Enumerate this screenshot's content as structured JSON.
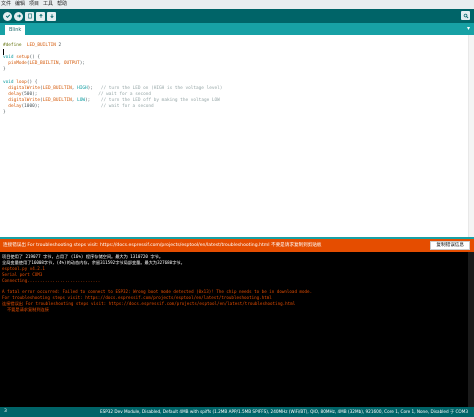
{
  "menu": [
    "文件",
    "编辑",
    "项目",
    "工具",
    "帮助"
  ],
  "toolbar": {
    "verify_icon": "check-icon",
    "upload_icon": "arrow-right-icon",
    "new_icon": "new-file-icon",
    "open_icon": "open-up-icon",
    "save_icon": "save-down-icon",
    "serial_icon": "magnifier-icon"
  },
  "tab": {
    "label": "Blink",
    "menu_glyph": "▾"
  },
  "code": [
    "#define  LED_BUILTIN 2",
    "",
    "void setup() {",
    "  pinMode(LED_BUILTIN, OUTPUT);",
    "}",
    "",
    "void loop() {",
    "  digitalWrite(LED_BUILTIN, HIGH);   // turn the LED on (HIGH is the voltage level)",
    "  delay(500);                       // wait for a second",
    "  digitalWrite(LED_BUILTIN, LOW);    // turn the LED off by making the voltage LOW",
    "  delay(1000);                       // wait for a second",
    "}"
  ],
  "status": {
    "message": "连接错误出 For troubleshooting steps visit: https://docs.espressif.com/projects/esptool/en/latest/troubleshooting.html 不要是请求复制到剪贴板",
    "copy_button": "复制错误信息",
    "color": "#e54d00"
  },
  "console": [
    {
      "text": "项目使用了 219077 字节，占用了 (16%) 程序存储空间。最大为 1310720 字节。",
      "warn": false
    },
    {
      "text": "全局变量使用了16008字节，(4%)的动态内存，余留311592字节局部变量。最大为327680字节。",
      "warn": false
    },
    {
      "text": "esptool.py v4.2.1",
      "warn": true
    },
    {
      "text": "Serial port COM3",
      "warn": true
    },
    {
      "text": "Connecting.............................",
      "warn": true
    },
    {
      "text": "",
      "warn": false
    },
    {
      "text": "A fatal error occurred: Failed to connect to ESP32: Wrong boot mode detected (0x13)! The chip needs to be in download mode.",
      "warn": true
    },
    {
      "text": "For troubleshooting steps visit: https://docs.espressif.com/projects/esptool/en/latest/troubleshooting.html",
      "warn": true
    },
    {
      "text": "连接错误出 For troubleshooting steps visit: https://docs.espressif.com/projects/esptool/en/latest/troubleshooting.html",
      "warn": true
    },
    {
      "text": "  不要是请求复制到连接",
      "warn": true
    }
  ],
  "bottom": {
    "line_number": "3",
    "board_info": "ESP32 Dev Module, Disabled, Default 4MB with spiffs (1.2MB APP/1.5MB SPIFFS), 240MHz (WiFi/BT), QIO, 80MHz, 4MB (32Mb), 921600, Core 1, Core 1, None, Disabled 于 COM3"
  },
  "colors": {
    "teal_dark": "#006468",
    "teal_light": "#17a1a5",
    "error_orange": "#e54d00"
  }
}
